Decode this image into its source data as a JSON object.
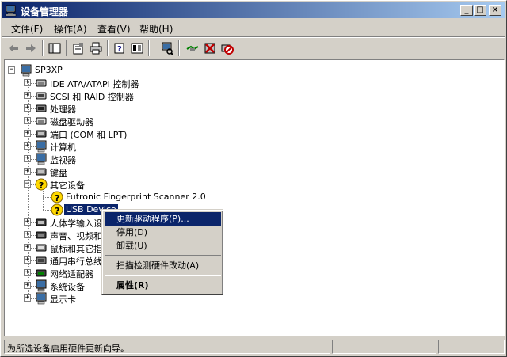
{
  "window": {
    "title": "设备管理器",
    "icon": "device-manager-icon",
    "buttons": {
      "minimize": "_",
      "maximize": "□",
      "close": "×"
    }
  },
  "menu": [
    {
      "label": "文件(F)"
    },
    {
      "label": "操作(A)"
    },
    {
      "label": "查看(V)"
    },
    {
      "label": "帮助(H)"
    }
  ],
  "toolbar": [
    "back-arrow-icon",
    "forward-arrow-icon",
    "show-hide-tree-icon",
    "properties-icon",
    "print-icon",
    "help-icon",
    "show-pane-icon",
    "scan-hardware-icon",
    "update-driver-icon",
    "uninstall-icon",
    "disable-icon"
  ],
  "tree": {
    "root": {
      "label": "SP3XP",
      "icon": "computer-icon"
    },
    "categories": [
      {
        "label": "IDE ATA/ATAPI 控制器",
        "icon": "ide-controller-icon"
      },
      {
        "label": "SCSI 和 RAID 控制器",
        "icon": "scsi-controller-icon"
      },
      {
        "label": "处理器",
        "icon": "processor-icon"
      },
      {
        "label": "磁盘驱动器",
        "icon": "disk-drive-icon"
      },
      {
        "label": "端口 (COM 和 LPT)",
        "icon": "port-icon"
      },
      {
        "label": "计算机",
        "icon": "computer-icon"
      },
      {
        "label": "监视器",
        "icon": "monitor-icon"
      },
      {
        "label": "键盘",
        "icon": "keyboard-icon"
      },
      {
        "label": "其它设备",
        "icon": "unknown-device-icon",
        "expanded": true,
        "children": [
          {
            "label": "Futronic Fingerprint Scanner 2.0",
            "icon": "warning-device-icon"
          },
          {
            "label": "USB Device",
            "icon": "warning-device-icon",
            "selected": true
          }
        ]
      },
      {
        "label": "人体学输入设备",
        "icon": "hid-icon"
      },
      {
        "label": "声音、视频和游戏控制器",
        "icon": "sound-icon"
      },
      {
        "label": "鼠标和其它指针设备",
        "icon": "mouse-icon"
      },
      {
        "label": "通用串行总线控制器",
        "icon": "usb-icon"
      },
      {
        "label": "网络适配器",
        "icon": "network-adapter-icon"
      },
      {
        "label": "系统设备",
        "icon": "system-device-icon"
      },
      {
        "label": "显示卡",
        "icon": "display-adapter-icon"
      }
    ]
  },
  "context_menu": [
    {
      "label": "更新驱动程序(P)...",
      "highlighted": true
    },
    {
      "label": "停用(D)"
    },
    {
      "label": "卸载(U)"
    },
    {
      "label": "扫描检测硬件改动(A)"
    },
    {
      "label": "属性(R)",
      "bold": true
    }
  ],
  "status": {
    "text": "为所选设备启用硬件更新向导。"
  }
}
